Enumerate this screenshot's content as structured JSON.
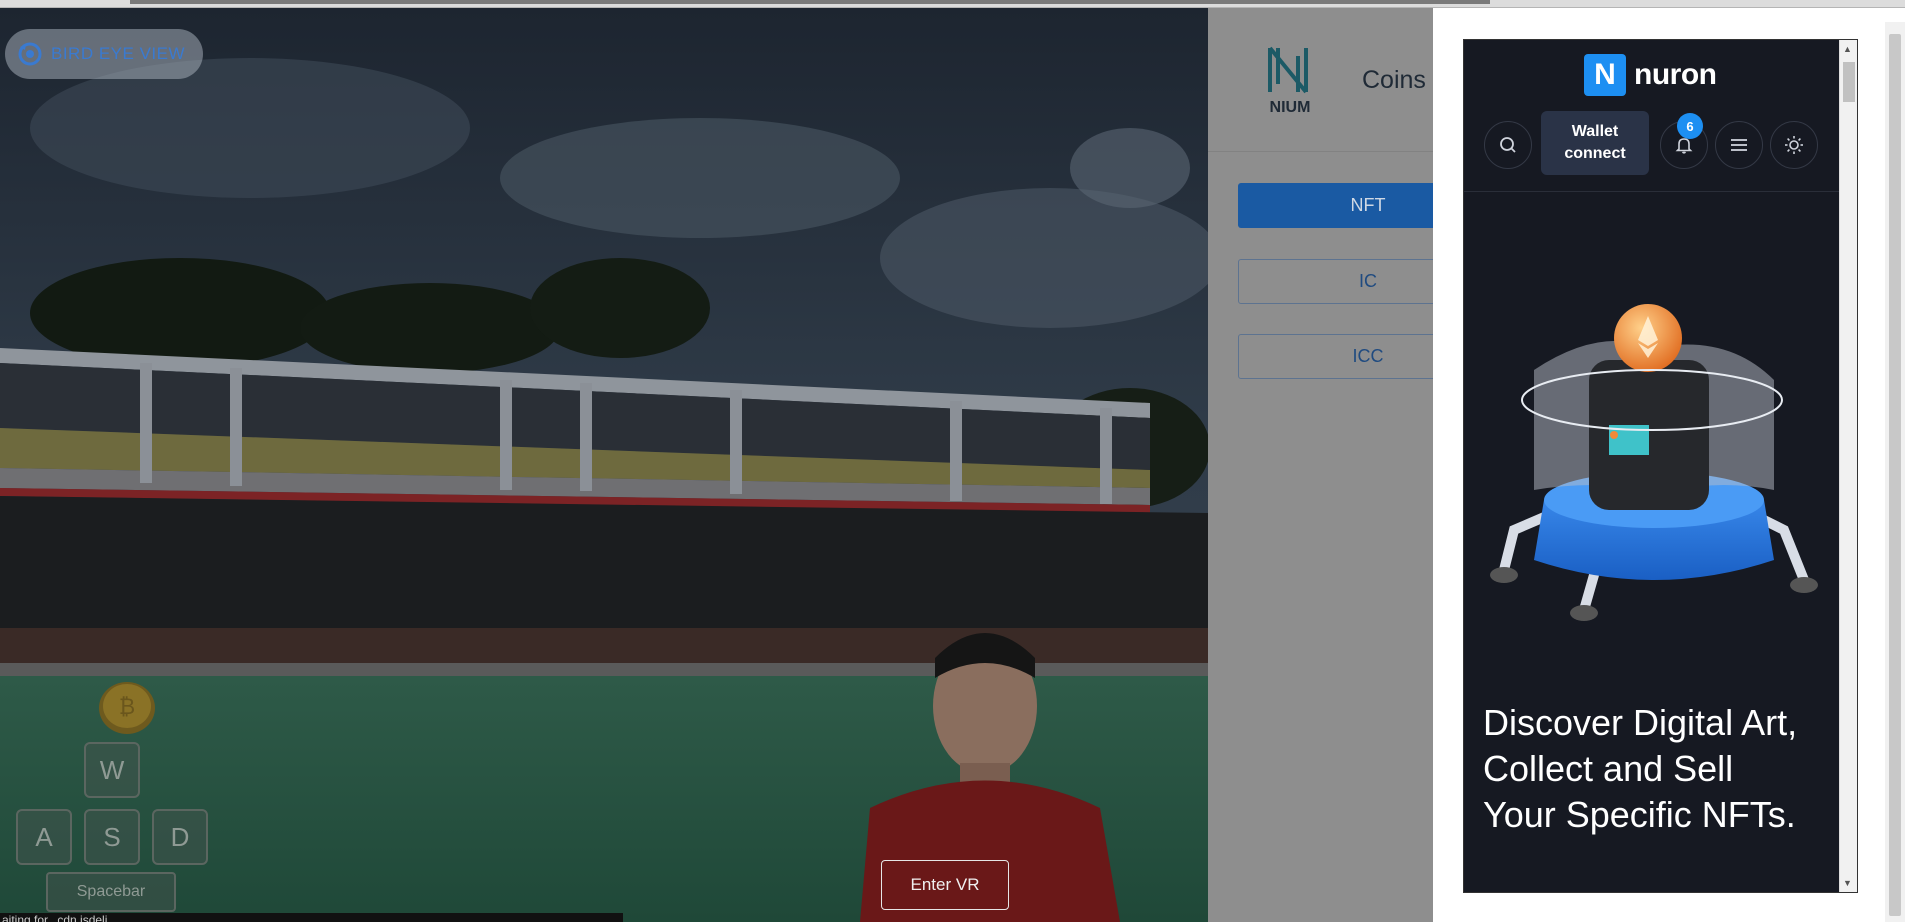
{
  "scene": {
    "bird_eye_label": "BIRD EYE VIEW",
    "enter_vr_label": "Enter VR",
    "keys": {
      "w": "W",
      "a": "A",
      "s": "S",
      "d": "D",
      "space": "Spacebar"
    },
    "status_text": "aiting for...cdn.jsdeli..."
  },
  "site": {
    "logo_text": "NIUM",
    "nav_item": "Coins",
    "buttons": {
      "nft": "NFT",
      "ic1": "IC",
      "ic2": "ICC"
    }
  },
  "popup": {
    "brand_letter": "N",
    "brand_name": "nuron",
    "wallet_label": "Wallet connect",
    "notification_count": "6",
    "headline": [
      "Discover Digital Art,",
      "Collect and Sell",
      "Your Specific NFTs."
    ]
  },
  "colors": {
    "accent": "#1d8ff2",
    "popup_bg": "#161922",
    "wallet_bg": "#2a3347",
    "site_primary": "#1a5aa3"
  },
  "icons": [
    "bird-eye-icon",
    "coin-icon",
    "search-icon",
    "bell-icon",
    "menu-icon",
    "sun-icon"
  ]
}
